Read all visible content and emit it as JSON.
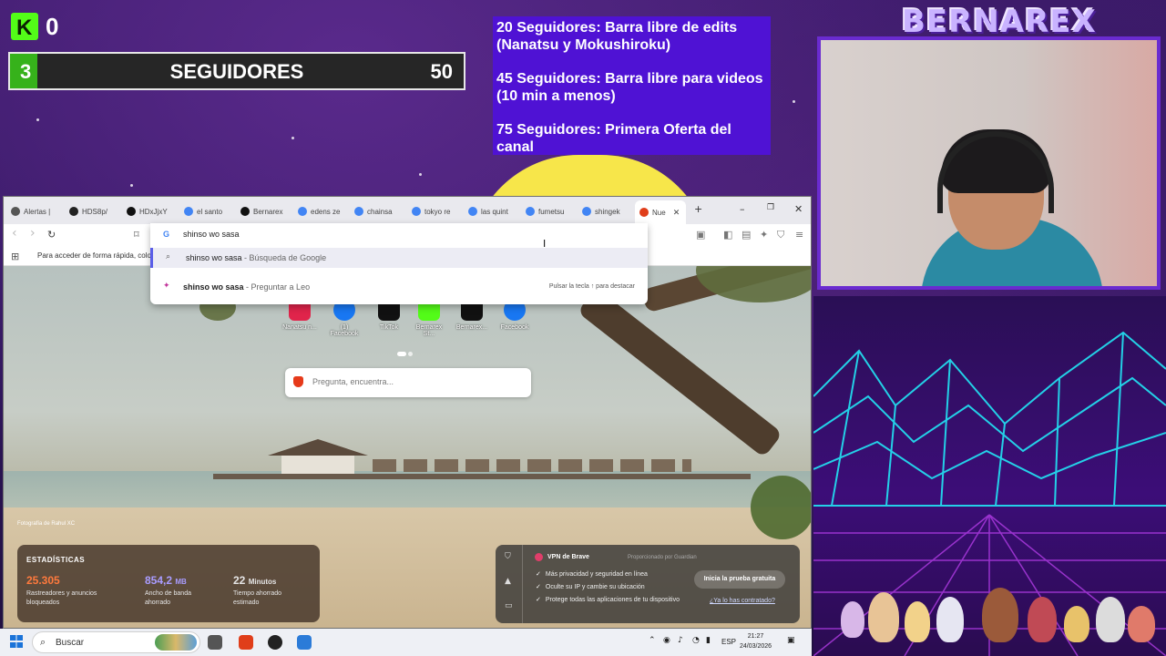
{
  "overlay": {
    "kick_count": "0",
    "kick_logo": "K",
    "followers": {
      "current": "3",
      "label": "SEGUIDORES",
      "goal": "50",
      "progress": 0.06
    },
    "goals": [
      "20 Seguidores: Barra libre de edits (Nanatsu y Mokushiroku)",
      "45 Seguidores: Barra libre para videos (10 min a menos)",
      "75 Seguidores: Primera Oferta del canal"
    ],
    "brand": "BERNAREX"
  },
  "browser": {
    "tabs": [
      {
        "label": "Alertas |",
        "icon": "brave-icon",
        "color": "#555555"
      },
      {
        "label": "HDS8p/",
        "icon": "github-icon",
        "color": "#222222"
      },
      {
        "label": "HDxJjxY",
        "icon": "x-icon",
        "color": "#111111"
      },
      {
        "label": "el santo",
        "icon": "google-icon",
        "color": "#4285f4"
      },
      {
        "label": "Bernarex",
        "icon": "x-icon",
        "color": "#111111"
      },
      {
        "label": "edens ze",
        "icon": "google-icon",
        "color": "#4285f4"
      },
      {
        "label": "chainsa",
        "icon": "google-icon",
        "color": "#4285f4"
      },
      {
        "label": "tokyo re",
        "icon": "google-icon",
        "color": "#4285f4"
      },
      {
        "label": "las quint",
        "icon": "google-icon",
        "color": "#4285f4"
      },
      {
        "label": "fumetsu",
        "icon": "google-icon",
        "color": "#4285f4"
      },
      {
        "label": "shingek",
        "icon": "google-icon",
        "color": "#4285f4"
      },
      {
        "label": "Nue",
        "icon": "brave-icon",
        "color": "#e03e1a",
        "active": true
      }
    ],
    "new_tab_symbol": "+",
    "window_controls": {
      "minimize": "–",
      "restore": "❐",
      "close": "✕"
    },
    "toolbar": {
      "back": "‹",
      "forward": "›",
      "reload": "↻",
      "bookmark": "⌑"
    },
    "bookmarks_hint": "Para acceder de forma rápida, coloc",
    "omnibox": {
      "value": "shinso wo sasa",
      "suggestions": [
        {
          "bold": "shinso wo sasa",
          "suffix": " - Búsqueda de Google",
          "icon": "search-icon",
          "selected": true
        },
        {
          "bold": "shinso wo sasa",
          "suffix": " - Preguntar a Leo",
          "icon": "leo-icon",
          "hint": "Pulsar la tecla ↑ para destacar"
        }
      ]
    },
    "shortcuts": [
      {
        "label": "Nanatsu n...",
        "color": "#e0244b"
      },
      {
        "label": "(1) Facebook",
        "color": "#1877f2"
      },
      {
        "label": "TikTok",
        "color": "#111111"
      },
      {
        "label": "Bernarex St...",
        "color": "#53fc18"
      },
      {
        "label": "Bernarex...",
        "color": "#111111"
      },
      {
        "label": "Facebook",
        "color": "#1877f2"
      }
    ],
    "search_placeholder": "Pregunta, encuentra...",
    "photo_credit": "Fotografía de Rahul XC",
    "stats": {
      "title": "ESTADÍSTICAS",
      "items": [
        {
          "value": "25.305",
          "unit": "",
          "label": "Rastreadores y anuncios bloqueados",
          "color": "#ff7a3d"
        },
        {
          "value": "854,2",
          "unit": "MB",
          "label": "Ancho de banda ahorrado",
          "color": "#a99cff"
        },
        {
          "value": "22",
          "unit": "Minutos",
          "label": "Tiempo ahorrado estimado",
          "color": "#ffffff"
        }
      ]
    },
    "vpn": {
      "title": "VPN de Brave",
      "provider": "Proporcionado por Guardian",
      "features": [
        "Más privacidad y seguridad en línea",
        "Oculte su IP y cambie su ubicación",
        "Protege todas las aplicaciones de tu dispositivo"
      ],
      "button": "Inicia la prueba gratuita",
      "link": "¿Ya lo has contratado?"
    }
  },
  "taskbar": {
    "search_label": "Buscar",
    "tray_lang": "ESP",
    "time": "21:27",
    "date": "24/03/2026"
  }
}
